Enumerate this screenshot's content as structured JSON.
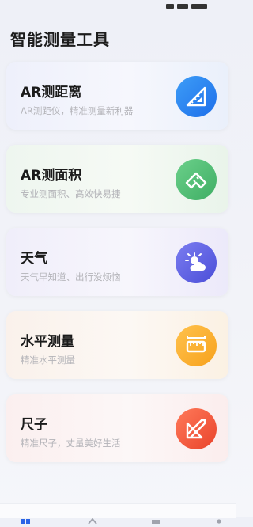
{
  "page": {
    "title": "智能测量工具"
  },
  "cards": [
    {
      "title": "AR测距离",
      "desc": "AR测距仪，精准测量新利器",
      "icon": "ruler-triangle-icon",
      "color": "#1e6fea"
    },
    {
      "title": "AR测面积",
      "desc": "专业测面积、高效快易捷",
      "icon": "area-measure-icon",
      "color": "#3fae64"
    },
    {
      "title": "天气",
      "desc": "天气早知道、出行没烦恼",
      "icon": "weather-sun-cloud-icon",
      "color": "#4b4ed8"
    },
    {
      "title": "水平测量",
      "desc": "精准水平测量",
      "icon": "level-ruler-icon",
      "color": "#f7a21d"
    },
    {
      "title": "尺子",
      "desc": "精准尺子，丈量美好生活",
      "icon": "ruler-icon",
      "color": "#e9432b"
    }
  ],
  "tab_bar": {
    "tabs": [
      {
        "icon": "home-tab-icon",
        "active": true
      },
      {
        "icon": "tools-tab-icon",
        "active": false
      },
      {
        "icon": "record-tab-icon",
        "active": false
      },
      {
        "icon": "profile-tab-icon",
        "active": false
      }
    ]
  }
}
